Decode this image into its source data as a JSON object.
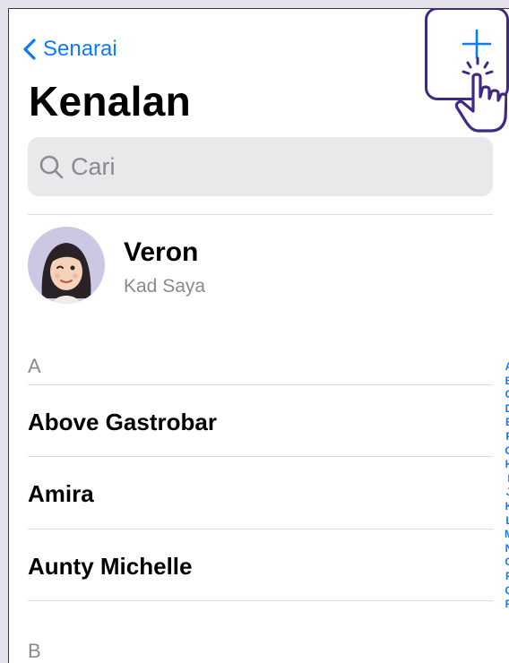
{
  "nav": {
    "back_label": "Senarai",
    "add_icon": "plus-icon"
  },
  "page": {
    "title": "Kenalan"
  },
  "search": {
    "placeholder": "Cari"
  },
  "my_card": {
    "name": "Veron",
    "subtitle": "Kad Saya"
  },
  "sections": [
    {
      "letter": "A",
      "contacts": [
        "Above Gastrobar",
        "Amira",
        "Aunty Michelle"
      ]
    },
    {
      "letter": "B",
      "contacts": []
    }
  ],
  "index_letters": [
    "A",
    "B",
    "C",
    "D",
    "E",
    "F",
    "G",
    "H",
    "I",
    "J",
    "K",
    "L",
    "M",
    "N",
    "O",
    "P",
    "Q",
    "R"
  ],
  "colors": {
    "accent": "#0a7aff",
    "highlight": "#3e2a84",
    "search_bg": "#e9e9eb",
    "secondary_text": "#8a8a8e"
  }
}
